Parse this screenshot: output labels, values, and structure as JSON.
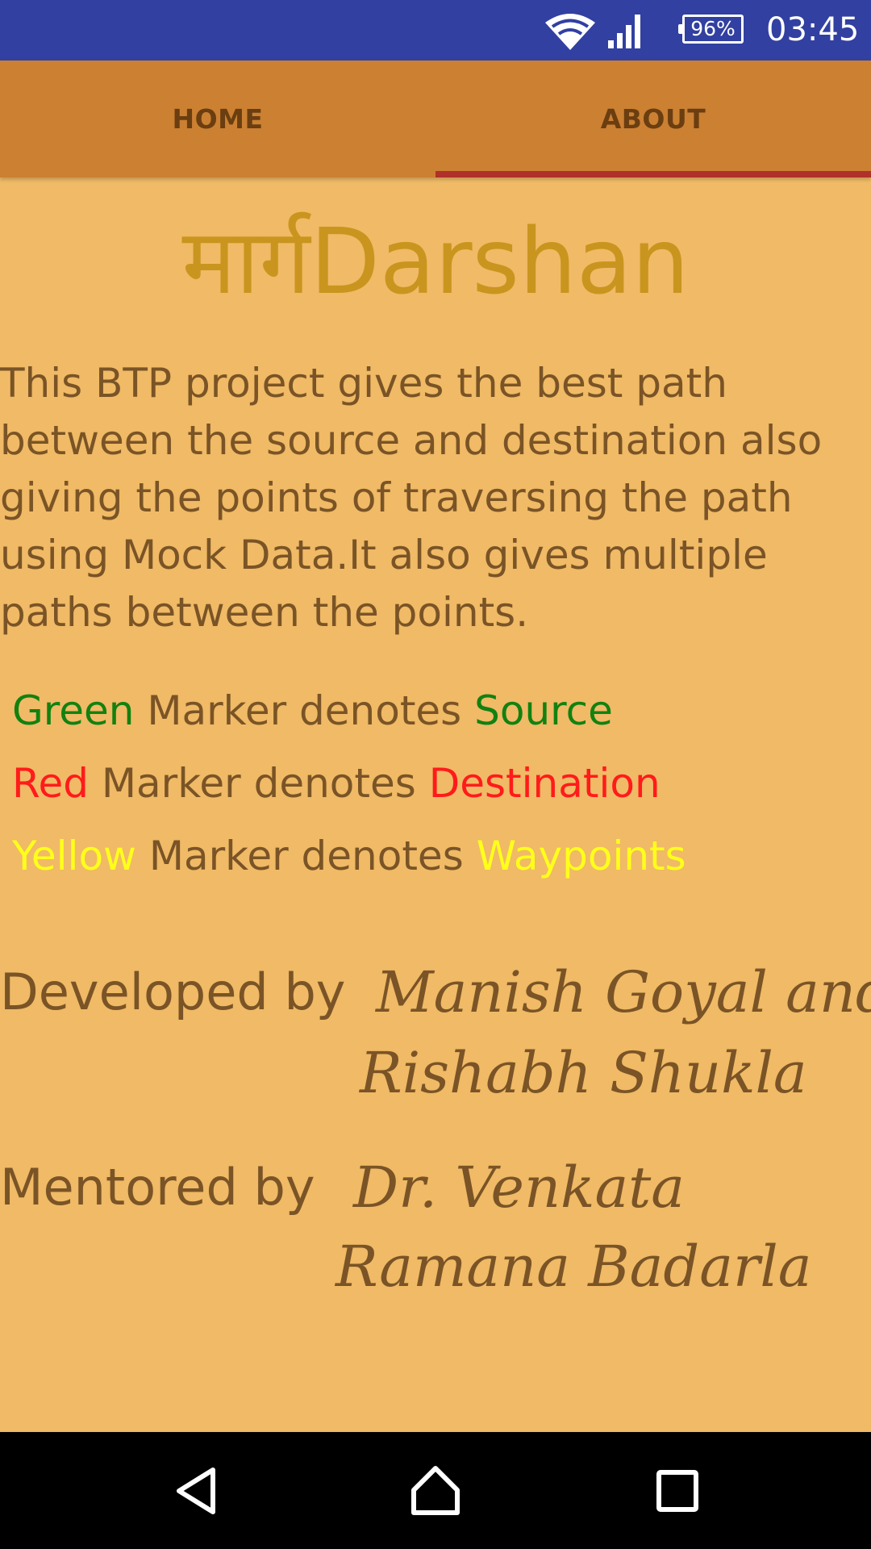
{
  "status_bar": {
    "battery": "96%",
    "time": "03:45",
    "icons": [
      "wifi-icon",
      "signal-icon",
      "battery-icon"
    ]
  },
  "tabs": [
    {
      "label": "HOME",
      "selected": false
    },
    {
      "label": "ABOUT",
      "selected": true
    }
  ],
  "content": {
    "title": "मार्गDarshan",
    "description": "This BTP project gives the best path between the source and destination also giving the points of traversing the path using Mock Data.It also gives multiple paths between the points.",
    "legend": [
      {
        "color_word": "Green",
        "middle": " Marker denotes ",
        "meaning": "Source",
        "color": "#128110"
      },
      {
        "color_word": "Red",
        "middle": " Marker denotes ",
        "meaning": "Destination",
        "color": "#FF1B1B"
      },
      {
        "color_word": "Yellow",
        "middle": " Marker denotes ",
        "meaning": "Waypoints",
        "color": "#FFFF1A"
      }
    ],
    "developed": {
      "prefix": "Developed by",
      "name_line1": "Manish Goyal and",
      "name_line2": "Rishabh Shukla"
    },
    "mentored": {
      "prefix": "Mentored by",
      "name_line1": "Dr. Venkata",
      "name_line2": "Ramana Badarla"
    }
  },
  "nav_bar": {
    "icons": [
      "back-icon",
      "home-icon",
      "recent-apps-icon"
    ]
  },
  "colors": {
    "status_bar": "#3140A1",
    "tab_bar": "#CC8032",
    "tab_indicator": "#B0302A",
    "background": "#F0BA66",
    "title": "#C9951E",
    "text": "#7A5426",
    "nav_bar": "#000000"
  }
}
